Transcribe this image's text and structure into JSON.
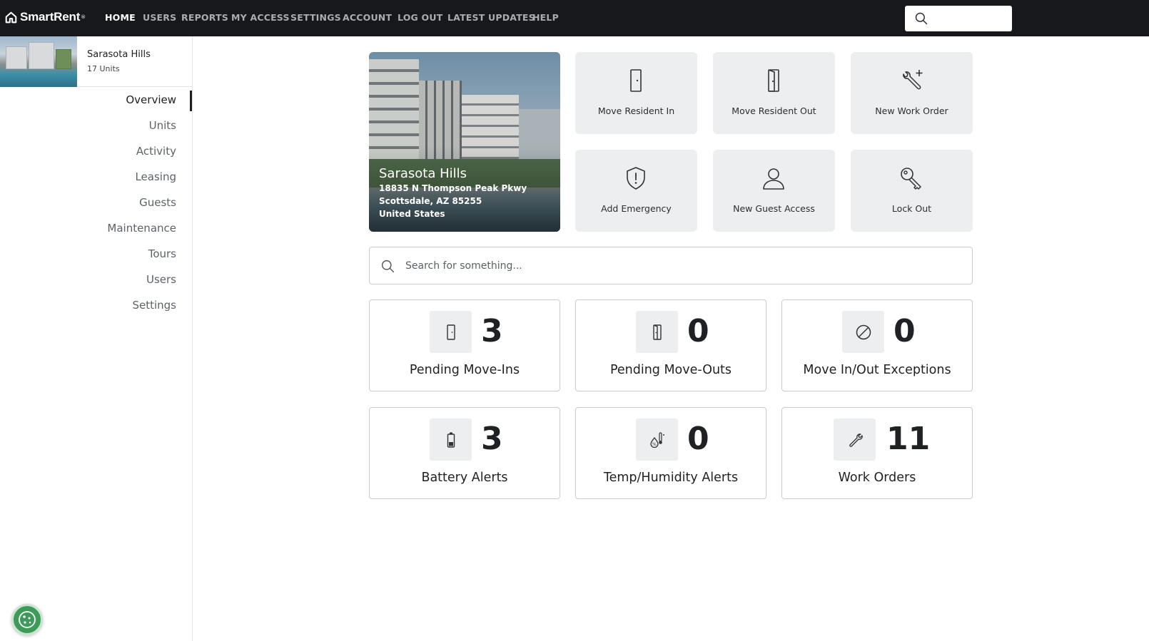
{
  "brand": {
    "name": "SmartRent",
    "trademark": "®"
  },
  "nav": {
    "items": [
      {
        "label": "HOME",
        "active": true
      },
      {
        "label": "USERS",
        "active": false
      },
      {
        "label": "REPORTS",
        "active": false
      },
      {
        "label": "MY ACCESS",
        "active": false
      },
      {
        "label": "SETTINGS",
        "active": false
      },
      {
        "label": "ACCOUNT",
        "active": false
      },
      {
        "label": "LOG OUT",
        "active": false
      },
      {
        "label": "LATEST UPDATES",
        "active": false
      },
      {
        "label": "HELP",
        "active": false
      }
    ],
    "search_icon": "search-icon"
  },
  "property": {
    "name": "Sarasota Hills",
    "units": "17 Units",
    "address_line1": "18835 N Thompson Peak Pkwy",
    "address_line2": "Scottsdale, AZ 85255",
    "country": "United States"
  },
  "sidebar": {
    "items": [
      {
        "label": "Overview",
        "active": true
      },
      {
        "label": "Units",
        "active": false
      },
      {
        "label": "Activity",
        "active": false
      },
      {
        "label": "Leasing",
        "active": false
      },
      {
        "label": "Guests",
        "active": false
      },
      {
        "label": "Maintenance",
        "active": false
      },
      {
        "label": "Tours",
        "active": false
      },
      {
        "label": "Users",
        "active": false
      },
      {
        "label": "Settings",
        "active": false
      }
    ],
    "cookie_icon": "cookie-icon"
  },
  "actions": [
    {
      "label": "Move Resident In",
      "icon": "door-closed-icon"
    },
    {
      "label": "Move Resident Out",
      "icon": "door-open-icon"
    },
    {
      "label": "New Work Order",
      "icon": "wrench-plus-icon"
    },
    {
      "label": "Add Emergency",
      "icon": "shield-alert-icon"
    },
    {
      "label": "New Guest Access",
      "icon": "person-icon"
    },
    {
      "label": "Lock Out",
      "icon": "key-icon"
    }
  ],
  "search": {
    "placeholder": "Search for something..."
  },
  "stats": [
    {
      "value": "3",
      "label": "Pending Move-Ins",
      "icon": "door-closed-icon"
    },
    {
      "value": "0",
      "label": "Pending Move-Outs",
      "icon": "door-open-icon"
    },
    {
      "value": "0",
      "label": "Move In/Out Exceptions",
      "icon": "no-entry-icon"
    },
    {
      "value": "3",
      "label": "Battery Alerts",
      "icon": "battery-icon"
    },
    {
      "value": "0",
      "label": "Temp/Humidity Alerts",
      "icon": "thermometer-drop-icon"
    },
    {
      "value": "11",
      "label": "Work Orders",
      "icon": "wrench-icon"
    }
  ],
  "colors": {
    "topbar": "#17181b",
    "tile": "#eceef0",
    "cookie": "#3e9a58"
  }
}
